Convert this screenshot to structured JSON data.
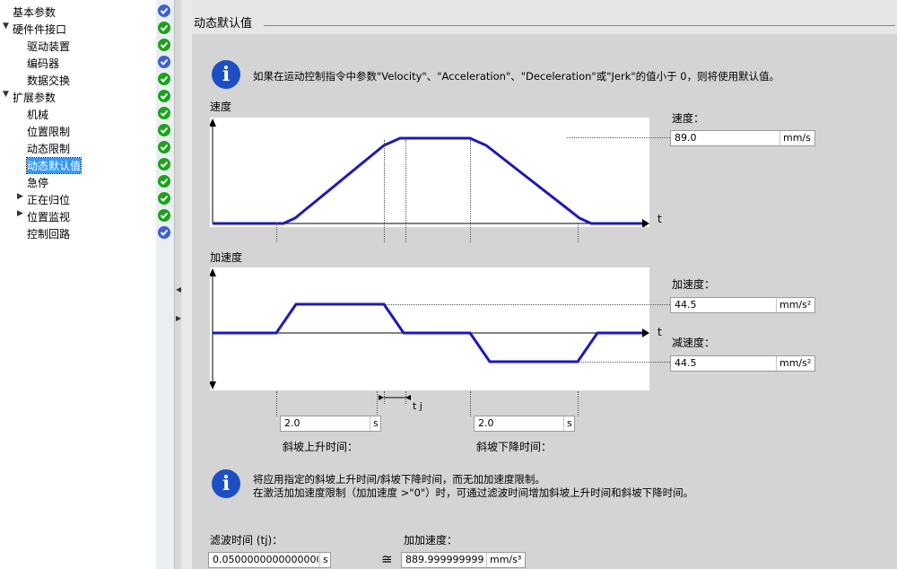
{
  "nav_tree": [
    {
      "label": "基本参数",
      "level": 0,
      "expander": "none",
      "status": "blue"
    },
    {
      "label": "硬件件接口",
      "level": 0,
      "expander": "expanded",
      "status": "ok"
    },
    {
      "label": "驱动装置",
      "level": 1,
      "expander": "none",
      "status": "ok"
    },
    {
      "label": "编码器",
      "level": 1,
      "expander": "none",
      "status": "blue"
    },
    {
      "label": "数据交换",
      "level": 1,
      "expander": "none",
      "status": "ok"
    },
    {
      "label": "扩展参数",
      "level": 0,
      "expander": "expanded",
      "status": "ok"
    },
    {
      "label": "机械",
      "level": 1,
      "expander": "none",
      "status": "ok"
    },
    {
      "label": "位置限制",
      "level": 1,
      "expander": "none",
      "status": "ok"
    },
    {
      "label": "动态限制",
      "level": 1,
      "expander": "none",
      "status": "ok"
    },
    {
      "label": "动态默认值",
      "level": 1,
      "expander": "none",
      "status": "ok",
      "selected": true
    },
    {
      "label": "急停",
      "level": 1,
      "expander": "none",
      "status": "ok"
    },
    {
      "label": "正在归位",
      "level": 1,
      "expander": "collapsed",
      "status": "ok"
    },
    {
      "label": "位置监视",
      "level": 1,
      "expander": "collapsed",
      "status": "ok"
    },
    {
      "label": "控制回路",
      "level": 1,
      "expander": "none",
      "status": "blue"
    }
  ],
  "section_title": "动态默认值",
  "info1": {
    "text": "如果在运动控制指令中参数\"Velocity\"、\"Acceleration\"、\"Deceleration\"或\"Jerk\"的值小于 0，则将使用默认值。"
  },
  "velocity_chart": {
    "title": "速度",
    "axis_t": "t"
  },
  "accel_chart": {
    "title": "加速度",
    "axis_t": "t",
    "jerk_label": "t j"
  },
  "velocity": {
    "label": "速度：",
    "value": "89.0",
    "unit": "mm/s"
  },
  "acceleration": {
    "label": "加速度：",
    "value": "44.5",
    "unit": "mm/s²"
  },
  "deceleration": {
    "label": "减速度：",
    "value": "44.5",
    "unit": "mm/s²"
  },
  "ramp_up": {
    "label": "斜坡上升时间：",
    "value": "2.0",
    "unit": "s"
  },
  "ramp_down": {
    "label": "斜坡下降时间：",
    "value": "2.0",
    "unit": "s"
  },
  "info2": {
    "line1": "将应用指定的斜坡上升时间/斜坡下降时间，而无加加速度限制。",
    "line2": "在激活加加速度限制（加加速度 >\"0\"）时，可通过滤波时间增加斜坡上升时间和斜坡下降时间。"
  },
  "filter_time": {
    "label": "滤波时间 (tj)：",
    "value": "0.05000000000000002",
    "unit": "s"
  },
  "jerk": {
    "label": "加加速度：",
    "value": "889.9999999999",
    "unit": "mm/s³"
  },
  "approx_symbol": "≅",
  "colors": {
    "curve": "#1a1ab8",
    "ok": "#1aa31a",
    "blue_status": "#3c5fd6",
    "info": "#1d4fc4",
    "selected": "#3399ff"
  }
}
